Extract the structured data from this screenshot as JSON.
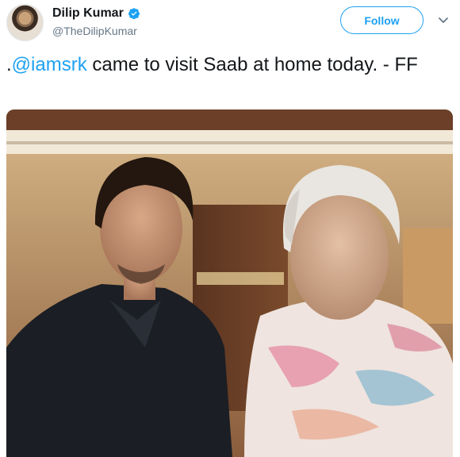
{
  "author": {
    "display_name": "Dilip Kumar",
    "handle": "@TheDilipKumar",
    "verified": true,
    "avatar_icon": "profile-avatar"
  },
  "follow_button": {
    "label": "Follow"
  },
  "menu": {
    "icon": "chevron-down-icon"
  },
  "tweet": {
    "prefix": ".",
    "mention": "@iamsrk",
    "text": " came to visit Saab at home today. - FF"
  },
  "media": {
    "type": "photo",
    "icon": "photo"
  },
  "colors": {
    "accent": "#1da1f2",
    "text": "#14171a",
    "secondary": "#657786"
  }
}
